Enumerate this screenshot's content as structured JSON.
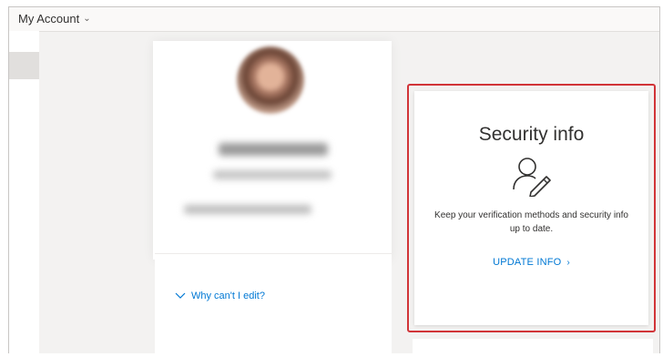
{
  "header": {
    "app_title": "My Account",
    "chevron_icon": "chevron-down-icon"
  },
  "profile": {
    "edit_help_label": "Why can't I edit?"
  },
  "security_card": {
    "title": "Security info",
    "icon": "person-edit-icon",
    "description": "Keep your verification methods and security info up to date.",
    "link_label": "UPDATE INFO",
    "link_icon": "chevron-right-icon",
    "highlight_color": "#d13438"
  },
  "colors": {
    "accent": "#0078d4",
    "text": "#323130",
    "background": "#f3f2f1"
  }
}
